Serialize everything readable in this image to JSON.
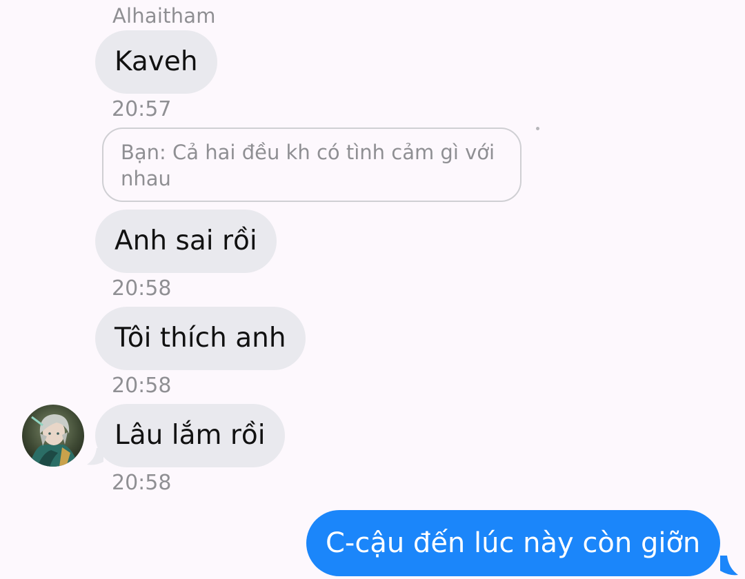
{
  "conversation": {
    "sender_name": "Alhaitham",
    "messages": [
      {
        "text": "Kaveh",
        "time": "20:57"
      },
      {
        "text": "Anh sai rồi",
        "time": "20:58"
      },
      {
        "text": "Tôi thích anh",
        "time": "20:58"
      },
      {
        "text": "Lâu lắm rồi",
        "time": "20:58"
      }
    ],
    "reply_preview": "Bạn: Cả hai đều kh có tình cảm gì với nhau",
    "sent_message": "C-cậu đến lúc này còn giỡn"
  },
  "colors": {
    "received_bubble": "#e9e9ee",
    "sent_bubble": "#1b86fa",
    "background": "#fdf8fd",
    "meta_text": "#8f8f93"
  }
}
